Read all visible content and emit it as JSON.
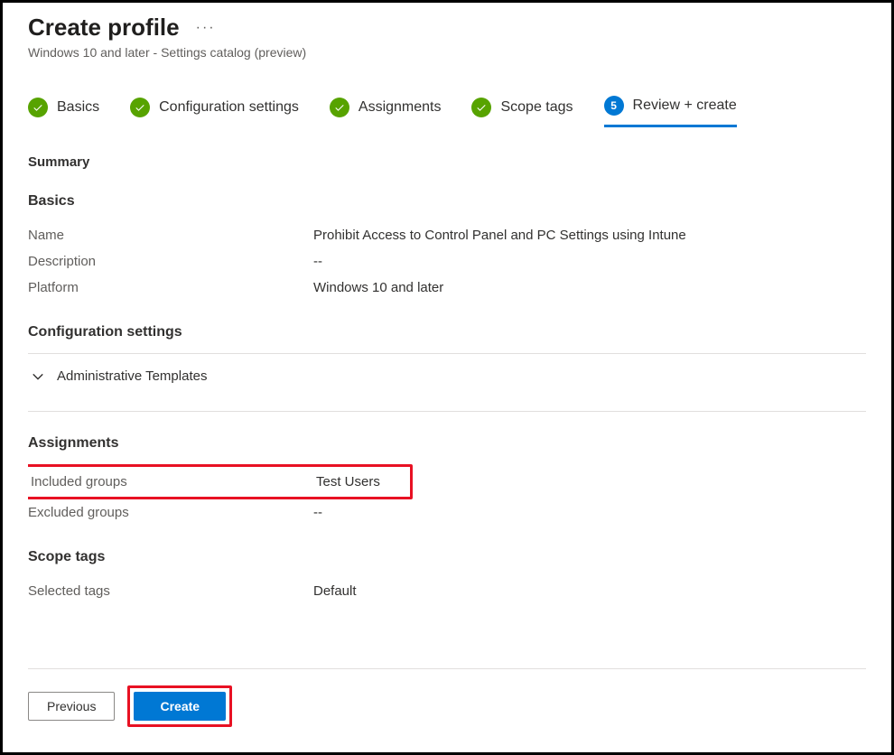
{
  "header": {
    "title": "Create profile",
    "subtitle": "Windows 10 and later - Settings catalog (preview)"
  },
  "wizard": {
    "steps": [
      {
        "label": "Basics",
        "state": "done"
      },
      {
        "label": "Configuration settings",
        "state": "done"
      },
      {
        "label": "Assignments",
        "state": "done"
      },
      {
        "label": "Scope tags",
        "state": "done"
      },
      {
        "label": "Review + create",
        "state": "active",
        "number": "5"
      }
    ]
  },
  "summary": {
    "heading": "Summary",
    "basics": {
      "heading": "Basics",
      "name_label": "Name",
      "name_value": "Prohibit Access to Control Panel and PC Settings using Intune",
      "description_label": "Description",
      "description_value": "--",
      "platform_label": "Platform",
      "platform_value": "Windows 10 and later"
    },
    "config": {
      "heading": "Configuration settings",
      "expander_label": "Administrative Templates"
    },
    "assignments": {
      "heading": "Assignments",
      "included_label": "Included groups",
      "included_value": "Test Users",
      "excluded_label": "Excluded groups",
      "excluded_value": "--"
    },
    "scope": {
      "heading": "Scope tags",
      "selected_label": "Selected tags",
      "selected_value": "Default"
    }
  },
  "footer": {
    "previous_label": "Previous",
    "create_label": "Create"
  }
}
